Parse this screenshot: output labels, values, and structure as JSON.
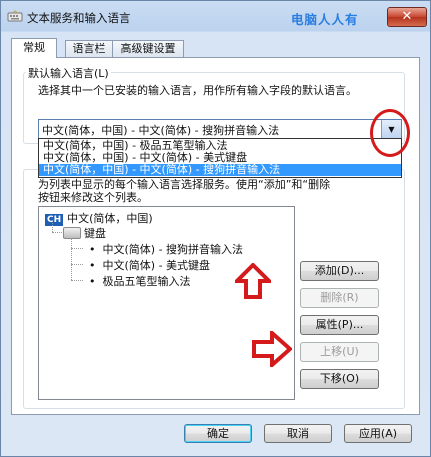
{
  "window": {
    "title": "文本服务和输入语言",
    "watermark": "电脑人人有",
    "close_glyph": "✕",
    "icon": "keyboard-app-icon"
  },
  "tabs": [
    {
      "label": "常规",
      "active": true
    },
    {
      "label": "语言栏",
      "active": false
    },
    {
      "label": "高级键设置",
      "active": false
    }
  ],
  "default_language": {
    "group_title": "默认输入语言(L)",
    "description": "选择其中一个已安装的输入语言，用作所有输入字段的默认语言。",
    "selected": "中文(简体，中国) - 中文(简体) - 搜狗拼音输入法",
    "dropdown_icon": "chevron-down-icon",
    "options": [
      {
        "label": "中文(简体，中国) - 极品五笔型输入法",
        "selected": false
      },
      {
        "label": "中文(简体，中国) - 中文(简体) - 美式键盘",
        "selected": false
      },
      {
        "label": "中文(简体，中国) - 中文(简体) - 搜狗拼音输入法",
        "selected": true
      }
    ]
  },
  "installed_services": {
    "description_line1": "为列表中显示的每个输入语言选择服务。使用“添加”和“删除",
    "description_line2": "按钮来修改这个列表。",
    "tree": {
      "language_code": "CH",
      "language": "中文(简体，中国)",
      "category": "键盘",
      "items": [
        "中文(简体) - 搜狗拼音输入法",
        "中文(简体) - 美式键盘",
        "极品五笔型输入法"
      ]
    },
    "buttons": {
      "add": "添加(D)...",
      "remove": "删除(R)",
      "properties": "属性(P)...",
      "move_up": "上移(U)",
      "move_down": "下移(O)"
    }
  },
  "footer": {
    "ok": "确定",
    "cancel": "取消",
    "apply": "应用(A)"
  },
  "colors": {
    "highlight": "#3399ff",
    "annotation_red": "#d41a1a",
    "watermark_blue": "#2a7de1"
  }
}
